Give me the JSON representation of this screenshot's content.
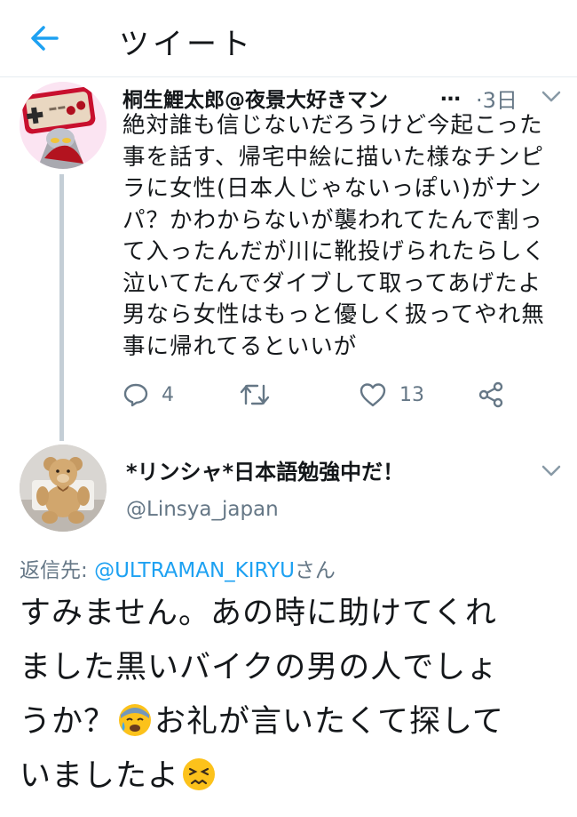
{
  "header": {
    "title": "ツイート",
    "back_icon": "back-arrow-icon",
    "accent": "#1da1f2"
  },
  "tweet1": {
    "display_name": "桐生鯉太郎@夜景大好きマン",
    "ellipsis": "…",
    "time": "·3日",
    "body": "絶対誰も信じないだろうけど今起こった\n事を話す、帰宅中絵に描いた様なチンピ\nラに女性(日本人じゃないっぽい)がナン\nパ？かわからないが襲われてたんで割っ\nて入ったんだが川に靴投げられたらしく\n泣いてたんでダイブして取ってあげたよ\n男なら女性はもっと優しく扱ってやれ無\n事に帰れてるといいが",
    "reply_count": "4",
    "retweet_count": "",
    "like_count": "13"
  },
  "tweet2": {
    "display_name": "*リンシャ*日本語勉強中だ！",
    "handle": "@Linsya_japan",
    "reply_prefix": "返信先: ",
    "reply_mention": "@ULTRAMAN_KIRYU",
    "reply_suffix": "さん",
    "body_part1": "すみません。あの時に助けてくれ\nました黒いバイクの男の人でしょ\nうか？",
    "emoji1": "anxious-sweat-face-emoji",
    "body_part2": "お礼が言いたくて探して\nいましたよ",
    "emoji2": "persevering-face-emoji"
  }
}
